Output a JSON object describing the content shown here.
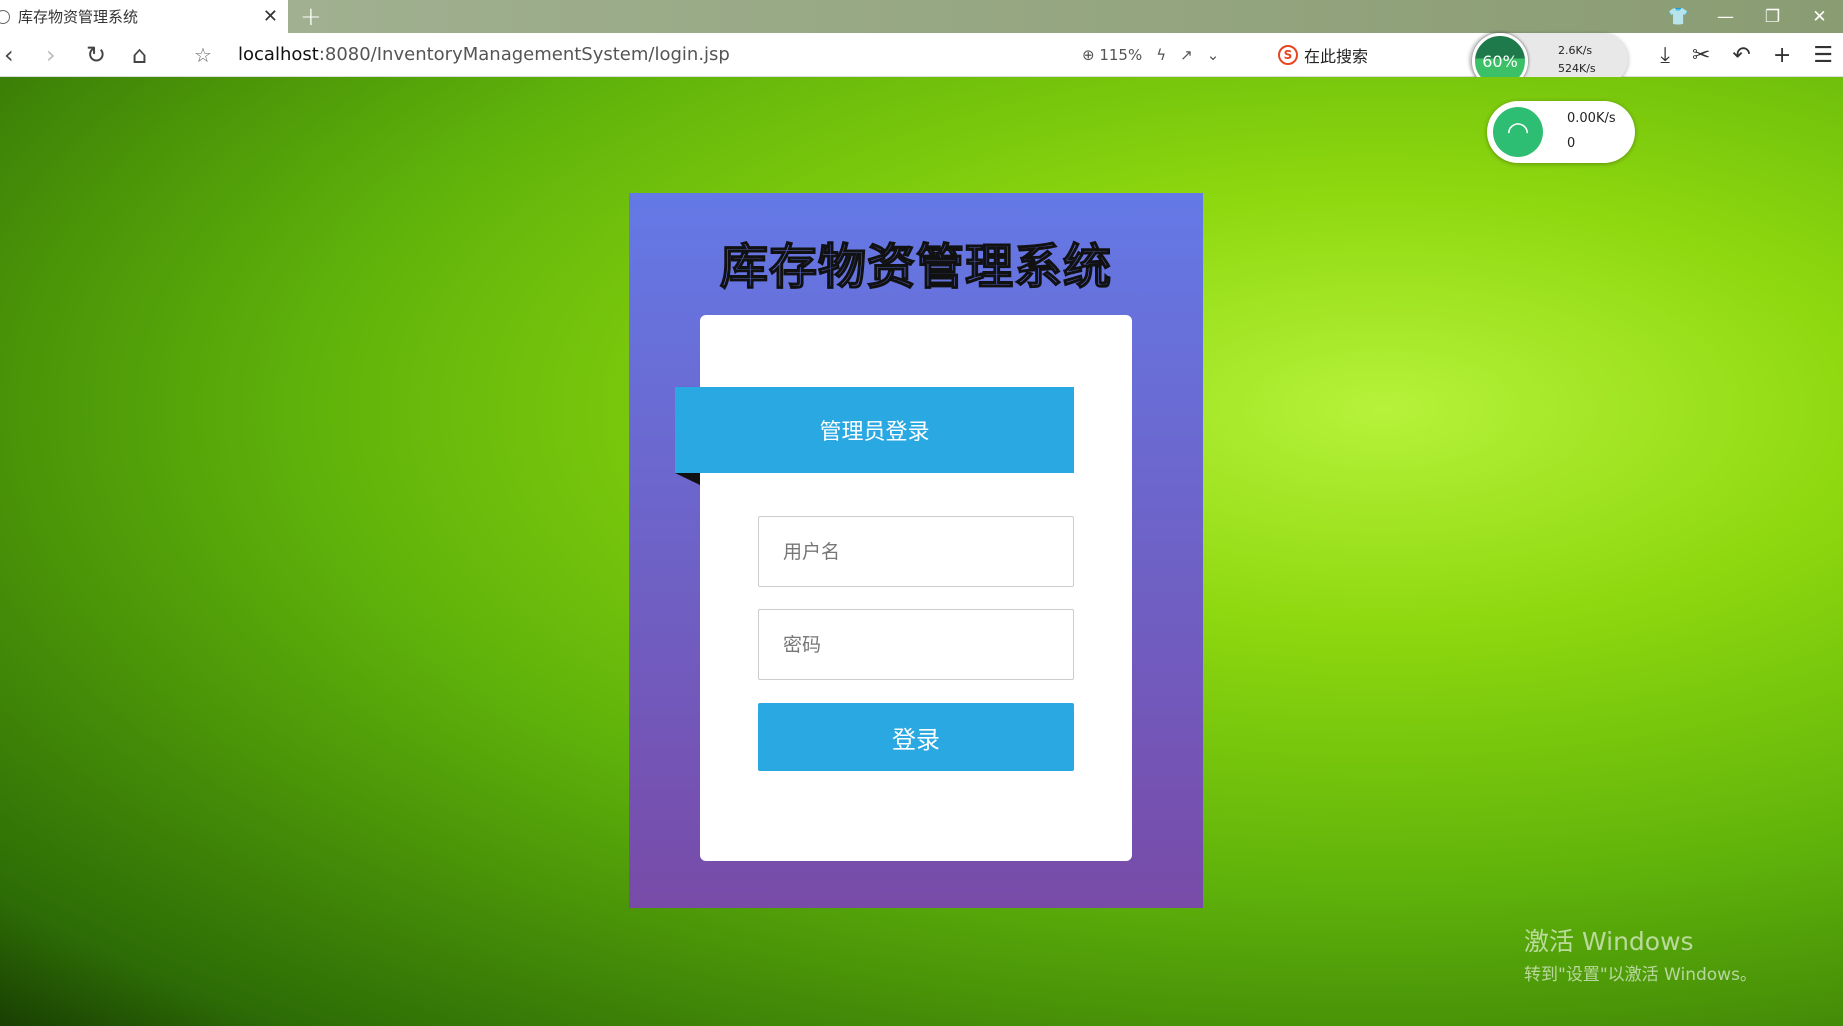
{
  "browser": {
    "tab_title": "库存物资管理系统",
    "url_host": "localhost",
    "url_rest": ":8080/InventoryManagementSystem/login.jsp",
    "zoom": "115%",
    "search_placeholder": "在此搜索"
  },
  "widgets": {
    "cpu": "60%",
    "upload": "2.6K/s",
    "download": "524K/s",
    "wifi_speed": "0.00K/s",
    "wifi_count": "0"
  },
  "login": {
    "system_title": "库存物资管理系统",
    "ribbon": "管理员登录",
    "username_placeholder": "用户名",
    "password_placeholder": "密码",
    "submit": "登录"
  },
  "watermark": {
    "line1": "激活 Windows",
    "line2": "转到\"设置\"以激活 Windows。"
  },
  "colors": {
    "accent": "#2aa8e2",
    "panel_top": "#6479e6",
    "panel_bottom": "#784ba8"
  }
}
